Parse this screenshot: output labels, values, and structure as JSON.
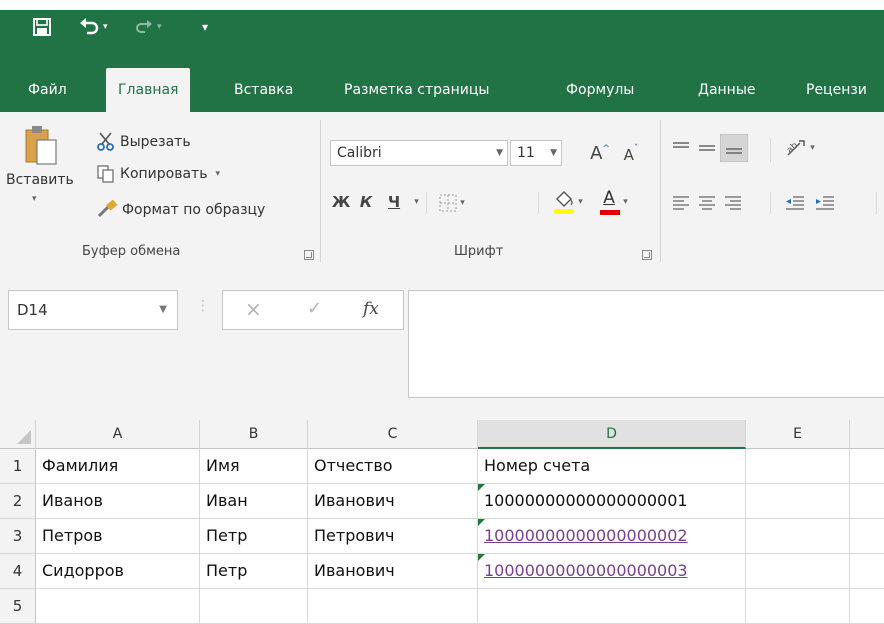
{
  "qat": {
    "save_icon": "save-icon",
    "undo_icon": "undo-icon",
    "redo_icon": "redo-icon",
    "customize_icon": "customize-qat-icon"
  },
  "tabs": [
    {
      "label": "Файл"
    },
    {
      "label": "Главная",
      "active": true
    },
    {
      "label": "Вставка"
    },
    {
      "label": "Разметка страницы"
    },
    {
      "label": "Формулы"
    },
    {
      "label": "Данные"
    },
    {
      "label": "Рецензи"
    }
  ],
  "clipboard": {
    "paste_label": "Вставить",
    "cut_label": "Вырезать",
    "copy_label": "Копировать",
    "format_painter_label": "Формат по образцу",
    "group_label": "Буфер обмена"
  },
  "font": {
    "font_name": "Calibri",
    "font_size": "11",
    "increase_size": "A",
    "decrease_size": "A",
    "bold": "Ж",
    "italic": "К",
    "underline": "Ч",
    "font_color_letter": "A",
    "group_label": "Шрифт",
    "fill_color": "#ffff00",
    "text_color": "#e00000"
  },
  "formula_bar": {
    "name_box": "D14",
    "cancel": "×",
    "enter": "✓",
    "fx": "fx",
    "content": ""
  },
  "sheet": {
    "columns": [
      "A",
      "B",
      "C",
      "D",
      "E"
    ],
    "selected_column": "D",
    "rows": [
      {
        "num": "1",
        "cells": [
          "Фамилия",
          "Имя",
          "Отчество",
          "Номер счета",
          ""
        ]
      },
      {
        "num": "2",
        "cells": [
          "Иванов",
          "Иван",
          "Иванович",
          "10000000000000000001",
          ""
        ]
      },
      {
        "num": "3",
        "cells": [
          "Петров",
          "Петр",
          "Петрович",
          "10000000000000000002",
          ""
        ]
      },
      {
        "num": "4",
        "cells": [
          "Сидорров",
          "Петр",
          "Иванович",
          "10000000000000000003",
          ""
        ]
      },
      {
        "num": "5",
        "cells": [
          "",
          "",
          "",
          "",
          ""
        ]
      }
    ]
  },
  "colors": {
    "accent": "#217346",
    "hyperlink": "#7a3e8c",
    "error_triangle": "#1e7b3c"
  }
}
